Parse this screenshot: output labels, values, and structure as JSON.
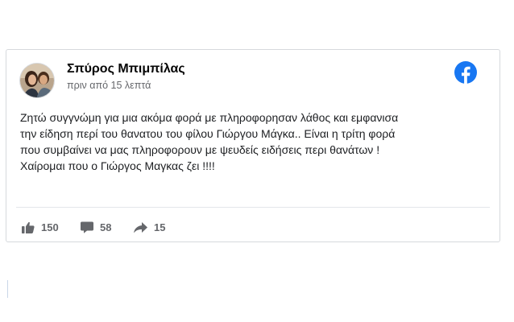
{
  "post": {
    "author": "Σπύρος Μπιμπίλας",
    "timestamp": "πριν από 15 λεπτά",
    "text_lines": [
      "Ζητώ συγγνώμη για μια ακόμα φορά με πληροφορησαν λάθος και εμφανισα",
      "την είδηση περί του θανατου του φίλου Γιώργου Μάγκα.. Είναι η τρίτη φορά",
      "που συμβαίνει να μας πληροφορουν με ψευδείς ειδήσεις περι θανάτων !",
      "Χαίρομαι που ο Γιώργος Μαγκας ζει !!!!"
    ]
  },
  "stats": {
    "likes": "150",
    "comments": "58",
    "shares": "15"
  },
  "icons": {
    "brand": "facebook-logo-icon",
    "like": "thumbs-up-icon",
    "comment": "comment-bubble-icon",
    "share": "share-arrow-icon"
  },
  "colors": {
    "facebook_blue": "#1877f2",
    "stat_gray": "#65676b",
    "text": "#1c1e21"
  }
}
